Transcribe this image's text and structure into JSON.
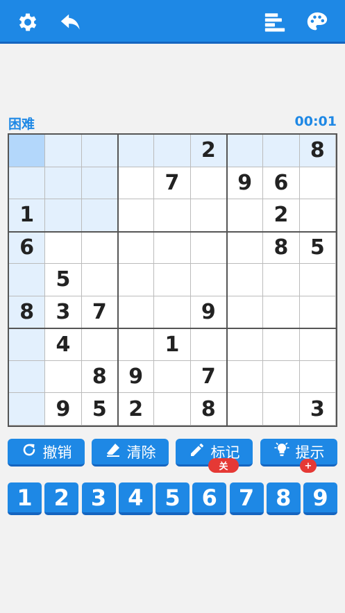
{
  "header": {
    "left_icons": [
      "gear-icon",
      "undo-arrow-icon"
    ],
    "right_icons": [
      "stats-bars-icon",
      "palette-icon"
    ],
    "accent": "#1e88e5"
  },
  "status": {
    "difficulty": "困难",
    "timer": "00:01"
  },
  "board": {
    "selected": [
      0,
      0
    ],
    "grid": [
      [
        "",
        "",
        "",
        "",
        "",
        "2",
        "",
        "",
        "8"
      ],
      [
        "",
        "",
        "",
        "",
        "7",
        "",
        "9",
        "6",
        ""
      ],
      [
        "1",
        "",
        "",
        "",
        "",
        "",
        "",
        "2",
        ""
      ],
      [
        "6",
        "",
        "",
        "",
        "",
        "",
        "",
        "8",
        "5"
      ],
      [
        "",
        "5",
        "",
        "",
        "",
        "",
        "",
        "",
        ""
      ],
      [
        "8",
        "3",
        "7",
        "",
        "",
        "9",
        "",
        "",
        ""
      ],
      [
        "",
        "4",
        "",
        "",
        "1",
        "",
        "",
        "",
        ""
      ],
      [
        "",
        "",
        "8",
        "9",
        "",
        "7",
        "",
        "",
        ""
      ],
      [
        "",
        "9",
        "5",
        "2",
        "",
        "8",
        "",
        "",
        "3"
      ]
    ]
  },
  "actions": {
    "undo_label": "撤销",
    "clear_label": "清除",
    "notes_label": "标记",
    "notes_badge": "关",
    "hint_label": "提示",
    "hint_badge": "+"
  },
  "numpad": [
    "1",
    "2",
    "3",
    "4",
    "5",
    "6",
    "7",
    "8",
    "9"
  ]
}
